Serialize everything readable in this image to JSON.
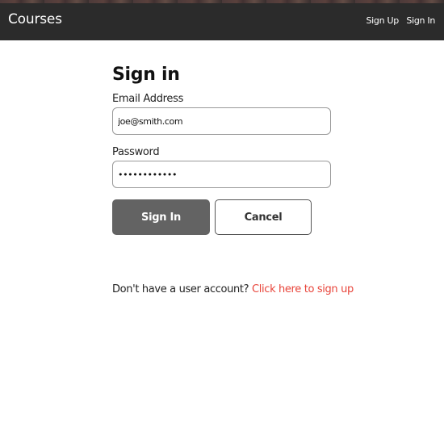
{
  "header": {
    "brand": "Courses",
    "nav": {
      "sign_up": "Sign Up",
      "sign_in": "Sign In"
    }
  },
  "form": {
    "title": "Sign in",
    "email": {
      "label": "Email Address",
      "value": "joe@smith.com"
    },
    "password": {
      "label": "Password",
      "value": "••••••••••••"
    },
    "buttons": {
      "submit": "Sign In",
      "cancel": "Cancel"
    }
  },
  "footer": {
    "prompt": "Don't have a user account?",
    "link": "Click here to sign up"
  },
  "colors": {
    "header_bg": "#2b2b2b",
    "primary_button": "#636363",
    "link": "#e8443a"
  }
}
